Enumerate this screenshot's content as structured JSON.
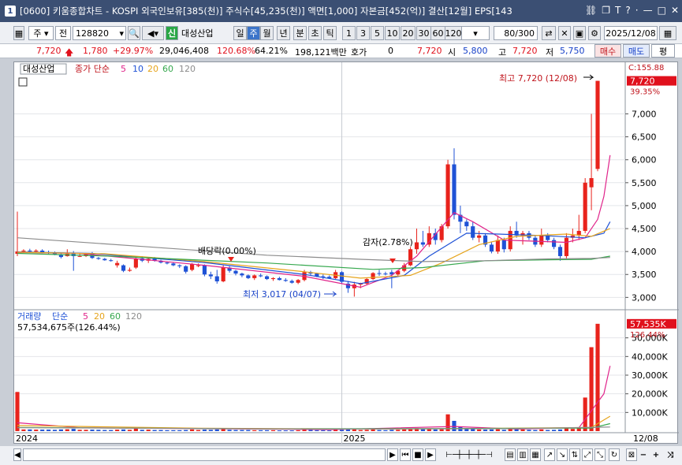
{
  "window": {
    "title": "[0600] 키움종합차트 - KOSPI 외국인보유[385(천)] 주식수[45,235(천)] 액면[1,000] 자본금[452(억)] 결산[12월] EPS[143",
    "number": "1"
  },
  "toolbar": {
    "type_label": "주",
    "market_label": "전",
    "code": "128820",
    "sin_badge": "신",
    "stock_name": "대성산업",
    "periods": [
      "일",
      "주",
      "월",
      "년",
      "분",
      "초",
      "틱"
    ],
    "selected_period": "주",
    "minute_options": [
      "1",
      "3",
      "5",
      "10",
      "20",
      "30",
      "60",
      "120"
    ],
    "count": "80",
    "count_total": "/300",
    "date": "2025/12/08"
  },
  "info": {
    "price": "7,720",
    "change": "1,780",
    "change_pct": "+29.97%",
    "volume": "29,046,408",
    "volume_ratio": "120.68%",
    "turnover": "64.21%",
    "amount": "198,121백만",
    "hoga_label": "호가",
    "hoga_value": "0",
    "hoga_price": "7,720",
    "open_label": "시",
    "open": "5,800",
    "high_label": "고",
    "high": "7,720",
    "low_label": "저",
    "low": "5,750",
    "buy_button": "매수",
    "sell_button": "매도",
    "eval_button": "평"
  },
  "chart_data": {
    "type": "candlestick",
    "price_legend": {
      "name": "대성산업",
      "ma_title": "종가 단순",
      "periods": [
        "5",
        "10",
        "20",
        "60",
        "120"
      ]
    },
    "price_axis": {
      "ticks": [
        "7,000",
        "6,500",
        "6,000",
        "5,500",
        "5,000",
        "4,500",
        "4,000",
        "3,500",
        "3,000"
      ],
      "min": 2800,
      "max": 7850,
      "top_label": "C:155.88"
    },
    "last_price_tag": "7,720",
    "last_pct_tag": "39.35%",
    "annotations": {
      "high": "최고 7,720 (12/08)",
      "low": "최저 3,017 (04/07)",
      "dividend": "배당락(0.00%)",
      "capital_reduction": "감자(2.78%)"
    },
    "volume_legend": {
      "name": "거래량",
      "ma_title": "단순",
      "periods": [
        "5",
        "20",
        "60",
        "120"
      ]
    },
    "volume_info": "57,534,675주(126.44%)",
    "volume_axis": {
      "ticks": [
        "50,000K",
        "40,000K",
        "30,000K",
        "20,000K",
        "10,000K"
      ],
      "max": 60000
    },
    "volume_last_tag": "57,535K",
    "volume_pct_tag": "126.44%",
    "x_labels": [
      "2024",
      "2025"
    ],
    "x_end_label": "12/08",
    "candles": [
      [
        3950,
        4870,
        3900,
        4000,
        0,
        21000
      ],
      [
        4000,
        4050,
        3970,
        4020,
        0,
        900
      ],
      [
        4020,
        4060,
        3980,
        4000,
        0,
        900
      ],
      [
        4000,
        4050,
        3980,
        4020,
        0,
        800
      ],
      [
        4020,
        4050,
        3960,
        3980,
        0,
        800
      ],
      [
        3980,
        4020,
        3940,
        3960,
        0,
        800
      ],
      [
        3960,
        4000,
        3920,
        3940,
        0,
        700
      ],
      [
        3940,
        3960,
        3850,
        3880,
        0,
        900
      ],
      [
        3900,
        4050,
        3890,
        3950,
        0,
        1000
      ],
      [
        3950,
        4010,
        3580,
        3900,
        0,
        1200
      ],
      [
        3900,
        3960,
        3880,
        3900,
        0,
        700
      ],
      [
        3900,
        3970,
        3880,
        3960,
        0,
        700
      ],
      [
        3960,
        3990,
        3840,
        3860,
        0,
        800
      ],
      [
        3860,
        3880,
        3820,
        3840,
        0,
        700
      ],
      [
        3840,
        3860,
        3800,
        3810,
        0,
        600
      ],
      [
        3810,
        3840,
        3780,
        3800,
        0,
        600
      ],
      [
        3700,
        3800,
        3650,
        3750,
        0,
        800
      ],
      [
        3700,
        3720,
        3550,
        3580,
        0,
        900
      ],
      [
        3580,
        3650,
        3560,
        3600,
        0,
        700
      ],
      [
        3650,
        3900,
        3620,
        3850,
        0,
        1500
      ],
      [
        3850,
        3900,
        3770,
        3800,
        0,
        700
      ],
      [
        3800,
        3860,
        3750,
        3840,
        0,
        800
      ],
      [
        3840,
        3880,
        3780,
        3800,
        0,
        600
      ],
      [
        3800,
        3820,
        3740,
        3760,
        0,
        600
      ],
      [
        3760,
        3780,
        3720,
        3740,
        0,
        500
      ],
      [
        3740,
        3760,
        3680,
        3700,
        0,
        500
      ],
      [
        3700,
        3720,
        3640,
        3680,
        0,
        500
      ],
      [
        3680,
        3700,
        3520,
        3560,
        0,
        600
      ],
      [
        3600,
        3750,
        3570,
        3730,
        0,
        900
      ],
      [
        3700,
        3740,
        3660,
        3700,
        0,
        600
      ],
      [
        3700,
        3720,
        3460,
        3500,
        0,
        800
      ],
      [
        3500,
        3560,
        3400,
        3460,
        0,
        700
      ],
      [
        3460,
        3600,
        3300,
        3350,
        0,
        900
      ],
      [
        3350,
        3700,
        3330,
        3650,
        0,
        1400
      ],
      [
        3650,
        3680,
        3540,
        3580,
        0,
        700
      ],
      [
        3580,
        3600,
        3480,
        3520,
        0,
        600
      ],
      [
        3520,
        3540,
        3440,
        3480,
        0,
        600
      ],
      [
        3480,
        3500,
        3400,
        3420,
        0,
        600
      ],
      [
        3420,
        3500,
        3380,
        3480,
        0,
        500
      ],
      [
        3480,
        3520,
        3440,
        3460,
        0,
        500
      ],
      [
        3460,
        3480,
        3380,
        3400,
        0,
        500
      ],
      [
        3400,
        3440,
        3360,
        3420,
        0,
        500
      ],
      [
        3420,
        3450,
        3370,
        3380,
        0,
        400
      ],
      [
        3380,
        3420,
        3340,
        3360,
        0,
        400
      ],
      [
        3360,
        3390,
        3300,
        3320,
        0,
        400
      ],
      [
        3320,
        3400,
        3290,
        3380,
        0,
        500
      ],
      [
        3380,
        3600,
        3350,
        3550,
        0,
        1100
      ],
      [
        3550,
        3580,
        3480,
        3520,
        0,
        600
      ],
      [
        3520,
        3540,
        3440,
        3460,
        0,
        500
      ],
      [
        3460,
        3500,
        3400,
        3450,
        0,
        500
      ],
      [
        3450,
        3480,
        3400,
        3420,
        0,
        400
      ],
      [
        3420,
        3600,
        3400,
        3550,
        0,
        800
      ],
      [
        3550,
        3570,
        3300,
        3340,
        0,
        700
      ],
      [
        3300,
        3360,
        3100,
        3200,
        0,
        1000
      ],
      [
        3200,
        3340,
        3017,
        3280,
        0,
        1200
      ],
      [
        3280,
        3320,
        3200,
        3300,
        0,
        600
      ],
      [
        3300,
        3420,
        3280,
        3400,
        0,
        700
      ],
      [
        3400,
        3550,
        3380,
        3530,
        0,
        900
      ],
      [
        3530,
        3600,
        3470,
        3520,
        0,
        600
      ],
      [
        3520,
        3560,
        3480,
        3510,
        0,
        500
      ],
      [
        3550,
        3600,
        3200,
        3500,
        1,
        700
      ],
      [
        3500,
        3600,
        3470,
        3580,
        0,
        700
      ],
      [
        3580,
        3750,
        3550,
        3700,
        0,
        900
      ],
      [
        3700,
        4100,
        3680,
        4050,
        0,
        1500
      ],
      [
        4050,
        4500,
        3950,
        4200,
        0,
        1600
      ],
      [
        4200,
        4450,
        4100,
        4150,
        0,
        1200
      ],
      [
        4150,
        4550,
        4100,
        4400,
        0,
        1200
      ],
      [
        4400,
        4500,
        4150,
        4250,
        0,
        900
      ],
      [
        4250,
        4600,
        4200,
        4550,
        0,
        1000
      ],
      [
        4550,
        6000,
        4500,
        5900,
        0,
        9000
      ],
      [
        5900,
        6250,
        4700,
        4800,
        0,
        5500
      ],
      [
        4800,
        5000,
        4400,
        4650,
        0,
        2200
      ],
      [
        4650,
        4700,
        4450,
        4550,
        0,
        1400
      ],
      [
        4550,
        4650,
        4250,
        4300,
        0,
        1200
      ],
      [
        4300,
        4450,
        4200,
        4350,
        0,
        900
      ],
      [
        4350,
        4400,
        4100,
        4150,
        0,
        800
      ],
      [
        4150,
        4200,
        3960,
        4000,
        0,
        900
      ],
      [
        4000,
        4350,
        3950,
        4250,
        0,
        1000
      ],
      [
        4250,
        4300,
        3980,
        4050,
        0,
        700
      ],
      [
        4050,
        4550,
        4000,
        4450,
        0,
        1200
      ],
      [
        4450,
        4650,
        4300,
        4350,
        0,
        1000
      ],
      [
        4350,
        4450,
        4150,
        4400,
        0,
        900
      ],
      [
        4400,
        4450,
        4250,
        4300,
        0,
        700
      ],
      [
        4300,
        4350,
        4100,
        4150,
        0,
        600
      ],
      [
        4150,
        4500,
        4100,
        4350,
        0,
        900
      ],
      [
        4350,
        4400,
        4200,
        4250,
        0,
        600
      ],
      [
        4250,
        4300,
        4050,
        4100,
        0,
        700
      ],
      [
        4100,
        4150,
        3800,
        3900,
        0,
        900
      ],
      [
        3900,
        4400,
        3850,
        4300,
        0,
        1500
      ],
      [
        4300,
        4500,
        4200,
        4350,
        0,
        1200
      ],
      [
        4350,
        4800,
        4250,
        4450,
        0,
        1500
      ],
      [
        4450,
        5600,
        4400,
        5500,
        0,
        18000
      ],
      [
        5400,
        7000,
        4900,
        5600,
        0,
        45000
      ],
      [
        5800,
        7720,
        5750,
        7720,
        0,
        57535
      ]
    ],
    "ma": {
      "ma5": {
        "color": "#e0238a",
        "points": [
          [
            0,
            3980
          ],
          [
            10,
            3960
          ],
          [
            30,
            3700
          ],
          [
            46,
            3460
          ],
          [
            55,
            3220
          ],
          [
            60,
            3480
          ],
          [
            64,
            3900
          ],
          [
            70,
            4850
          ],
          [
            73,
            4650
          ],
          [
            78,
            4250
          ],
          [
            88,
            4200
          ],
          [
            91,
            4300
          ],
          [
            93,
            4700
          ],
          [
            94,
            5200
          ],
          [
            95,
            6100
          ]
        ]
      },
      "ma10": {
        "color": "#1f52d6",
        "points": [
          [
            0,
            3990
          ],
          [
            12,
            3960
          ],
          [
            30,
            3760
          ],
          [
            46,
            3500
          ],
          [
            55,
            3300
          ],
          [
            62,
            3480
          ],
          [
            66,
            3900
          ],
          [
            72,
            4400
          ],
          [
            77,
            4380
          ],
          [
            84,
            4350
          ],
          [
            91,
            4300
          ],
          [
            94,
            4400
          ],
          [
            95,
            4650
          ]
        ]
      },
      "ma20": {
        "color": "#e6a41c",
        "points": [
          [
            0,
            3985
          ],
          [
            14,
            3950
          ],
          [
            30,
            3780
          ],
          [
            46,
            3560
          ],
          [
            55,
            3420
          ],
          [
            63,
            3480
          ],
          [
            68,
            3750
          ],
          [
            74,
            4150
          ],
          [
            80,
            4330
          ],
          [
            88,
            4380
          ],
          [
            92,
            4330
          ],
          [
            95,
            4500
          ]
        ]
      },
      "ma60": {
        "color": "#36a84e",
        "points": [
          [
            0,
            3960
          ],
          [
            15,
            3900
          ],
          [
            40,
            3750
          ],
          [
            57,
            3610
          ],
          [
            65,
            3650
          ],
          [
            75,
            3800
          ],
          [
            85,
            3820
          ],
          [
            92,
            3830
          ],
          [
            95,
            3900
          ]
        ]
      },
      "ma120": {
        "color": "#8c8c8c",
        "points": [
          [
            0,
            4300
          ],
          [
            20,
            4110
          ],
          [
            40,
            3920
          ],
          [
            55,
            3830
          ],
          [
            65,
            3780
          ],
          [
            75,
            3800
          ],
          [
            85,
            3840
          ],
          [
            92,
            3850
          ],
          [
            95,
            3870
          ]
        ]
      }
    },
    "vol_ma": {
      "vma5": {
        "color": "#e0238a",
        "points": [
          [
            0,
            4500
          ],
          [
            10,
            1800
          ],
          [
            50,
            800
          ],
          [
            70,
            2500
          ],
          [
            80,
            1100
          ],
          [
            90,
            1800
          ],
          [
            94,
            20000
          ],
          [
            95,
            35000
          ]
        ]
      },
      "vma20": {
        "color": "#e6a41c",
        "points": [
          [
            0,
            3000
          ],
          [
            30,
            1500
          ],
          [
            60,
            1100
          ],
          [
            80,
            1600
          ],
          [
            92,
            2000
          ],
          [
            95,
            8000
          ]
        ]
      },
      "vma60": {
        "color": "#36a84e",
        "points": [
          [
            0,
            2000
          ],
          [
            40,
            1200
          ],
          [
            70,
            1400
          ],
          [
            92,
            1600
          ],
          [
            95,
            4000
          ]
        ]
      },
      "vma120": {
        "color": "#8c8c8c",
        "points": [
          [
            0,
            1800
          ],
          [
            50,
            1100
          ],
          [
            80,
            1300
          ],
          [
            95,
            2200
          ]
        ]
      }
    },
    "colors": {
      "up": "#e8231c",
      "down": "#1f52d6"
    }
  }
}
